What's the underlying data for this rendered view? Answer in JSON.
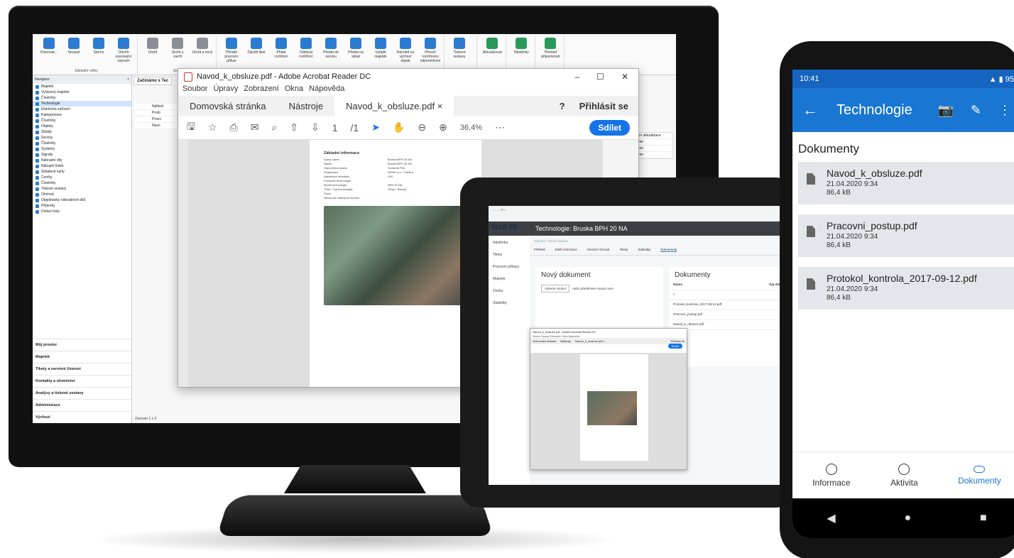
{
  "monitor": {
    "ribbon_groups": [
      {
        "caption": "Základní volby",
        "buttons": [
          "Klonovat...",
          "Smazat",
          "Storno",
          "Otevřít související záznam"
        ]
      },
      {
        "caption": "Uložit",
        "buttons": [
          "Uložit",
          "Uložit a zavřít",
          "Uložit a nový"
        ]
      },
      {
        "caption": "Akce",
        "buttons": [
          "Přiřadit pracovní příkaz",
          "Založit tiket",
          "Přidat rozšíření",
          "Odebrat rozšíření",
          "Předat do servisu",
          "Předat na sklad",
          "Vyřadit majetek",
          "Navrátit na výchozí objekt",
          "Převzít rozšířenou odpovědnost"
        ]
      },
      {
        "caption": "Tiskové sestavy",
        "buttons": [
          "Tiskové sestavy"
        ]
      },
      {
        "caption": "Zobrazit",
        "buttons": [
          "Aktualizovat"
        ]
      },
      {
        "caption": "Filtrování",
        "buttons": [
          "Nástěnky"
        ]
      },
      {
        "caption": "Připomenutí",
        "buttons": [
          "Přehled připomenutí"
        ]
      }
    ],
    "nav": {
      "title": "Navigace",
      "tree": [
        "Majetek",
        "Vyřazený majetek",
        "Číselníky",
        "Technologie",
        "Elektrická zařízení",
        "Kategorizace",
        "Číselníky",
        "Objekty",
        "Sklady",
        "Servisy",
        "Číselníky",
        "Systémy",
        "Signály",
        "Náhradní díly",
        "Nákupní lístek",
        "Skladové karty",
        "Ceníky",
        "Číselníky",
        "Tiskové sestavy",
        "Obchod",
        "Objednávky náhradních dílů",
        "Příjemky",
        "Dodací listy"
      ],
      "selected_index": 3,
      "sections": [
        "Můj prostor",
        "Majetek",
        "Tikety a servisní činnost",
        "Kontakty a účetnictví",
        "Analýzy a tiskové sestavy",
        "Administrace",
        "Výchozí"
      ]
    },
    "doc_tab": "Začínáme s Tec",
    "grid_rows": [
      "Náhled",
      "Proto",
      "Praco",
      "Navo"
    ],
    "right_col": [
      "sední aktualizace",
      "pdater",
      "pdater",
      "pdater"
    ],
    "pager": "Záznam 1 z 3"
  },
  "acrobat": {
    "title": "Navod_k_obsluze.pdf - Adobe Acrobat Reader DC",
    "menu": [
      "Soubor",
      "Úpravy",
      "Zobrazení",
      "Okna",
      "Nápověda"
    ],
    "tabs": [
      "Domovská stránka",
      "Nástroje",
      "Navod_k_obsluze.pdf ×"
    ],
    "login": "Přihlásit se",
    "help": "?",
    "page_num": "1",
    "page_total": "/1",
    "zoom": "36,4%",
    "share": "Sdílet",
    "pdf_heading": "Základní informace",
    "pdf_rows": [
      [
        "Úplný název",
        "Bruska BPH 20 NA"
      ],
      [
        "Název",
        "Bruska BPH 20 NA"
      ],
      [
        "Odpovědná osoba",
        "Svoboda Petr"
      ],
      [
        "Organizace",
        "DEMO a.s. / Údržba"
      ],
      [
        "Nákladové středisko",
        "H10"
      ],
      [
        "Počítadlo technologie",
        ""
      ],
      [
        "Model technologie",
        "BPH 20 NA"
      ],
      [
        "Třída / Typ technologie",
        "Stroje / Bruska"
      ],
      [
        "Popis",
        ""
      ],
      [
        "Nerezová nástrojová bruska",
        ""
      ]
    ]
  },
  "tablet": {
    "logo": "tech IS",
    "header": "Technologie: Bruska BPH 20 NA",
    "side": [
      "Nástěnka",
      "Tikety",
      "Pracovní příkazy",
      "Majetek",
      "Osoby",
      "Statistiky"
    ],
    "breadcrumb": "Majetek / Detail majetku",
    "tabs": [
      "Přehled",
      "Další informace",
      "Servisní činnost",
      "Tikety",
      "Statistiky",
      "Dokumenty"
    ],
    "new_doc_title": "Nový dokument",
    "choose_file": "Vyberte soubor",
    "drop_hint": "nebo přetáhnete soubor sem",
    "docs_title": "Dokumenty",
    "col_name": "Název",
    "col_type": "Typ dokumentu",
    "docs": [
      "Protokol_kontrola_2017-09-12.pdf",
      "Pracovni_postup.pdf",
      "Navod_k_obsluze.pdf"
    ],
    "acro_title": "Navod_k_obsluze.pdf - Adobe Acrobat Reader DC",
    "acro_menu": "Soubor Úpravy Zobrazení Okna Nápověda",
    "acro_tabs": [
      "Domovská stránka",
      "Nástroje",
      "Navod_k_obsluze.pdf ×"
    ],
    "acro_login": "Přihlásit se",
    "acro_share": "Sdílet"
  },
  "phone": {
    "time": "10:41",
    "battery": "95",
    "title": "Technologie",
    "section": "Dokumenty",
    "documents": [
      {
        "name": "Navod_k_obsluze.pdf",
        "date": "21.04.2020 9:34",
        "size": "86,4 kB"
      },
      {
        "name": "Pracovni_postup.pdf",
        "date": "21.04.2020 9:34",
        "size": "86,4 kB"
      },
      {
        "name": "Protokol_kontrola_2017-09-12.pdf",
        "date": "21.04.2020 9:34",
        "size": "86,4 kB"
      }
    ],
    "bottom_nav": [
      "Informace",
      "Aktivita",
      "Dokumenty"
    ],
    "active_tab": "Dokumenty",
    "accent": "#1976d2"
  }
}
